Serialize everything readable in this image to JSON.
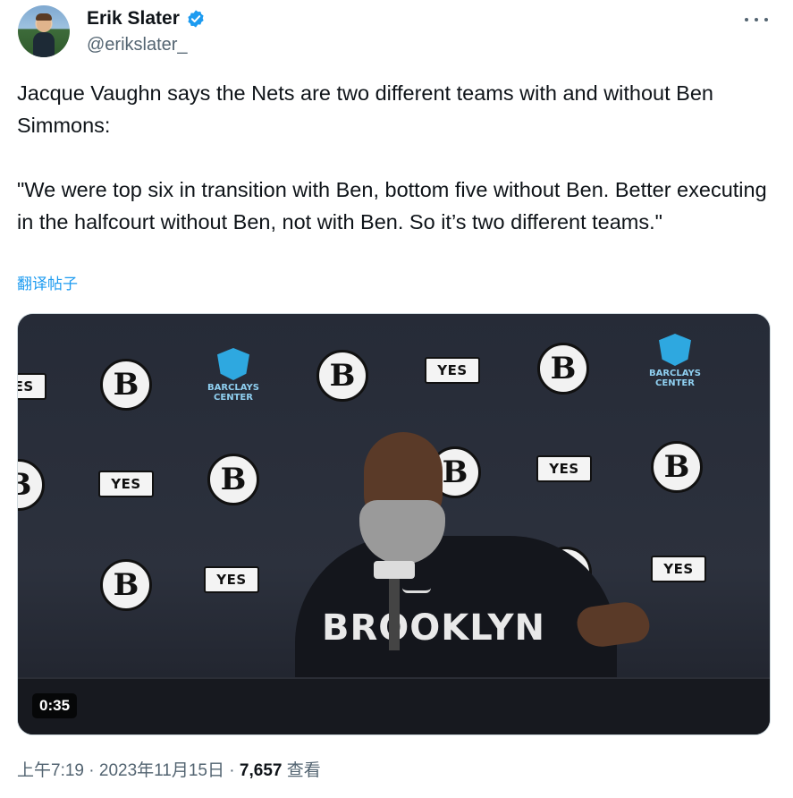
{
  "author": {
    "display_name": "Erik Slater",
    "handle": "@erikslater_",
    "verified": true,
    "verified_color": "#1d9bf0"
  },
  "tweet": {
    "line1": "Jacque Vaughn says the Nets are two different teams with and without Ben Simmons:",
    "line2": "\"We were top six in transition with Ben, bottom five without Ben. Better executing in the halfcourt without Ben, not with Ben. So it’s two different teams.\"",
    "translate_label": "翻译帖子"
  },
  "media": {
    "duration": "0:35",
    "shirt_text": "BROOKLYN",
    "b_logo_text": "B",
    "yes_logo_text": "YES",
    "barclays_text": "BARCLAYS CENTER"
  },
  "meta": {
    "time": "上午7:19",
    "separator": " · ",
    "date": "2023年11月15日",
    "views": "7,657",
    "views_label": " 查看"
  },
  "colors": {
    "accent": "#1d9bf0",
    "secondary_text": "#536471",
    "primary_text": "#0f1419"
  }
}
